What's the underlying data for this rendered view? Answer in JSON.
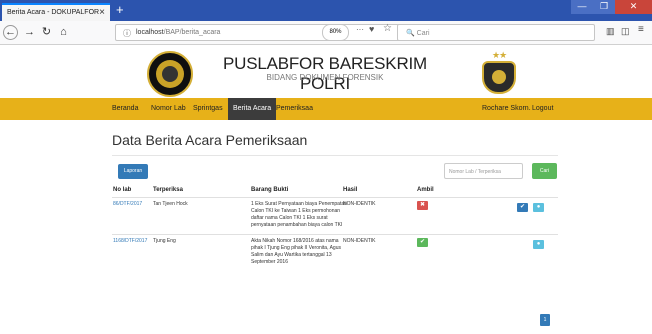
{
  "browser": {
    "tab_title": "Berita Acara - DOKUPALFOR",
    "tab_close": "×",
    "new_tab": "+",
    "url_host": "localhost",
    "url_path": "/BAP/berita_acara",
    "zoom": "80%",
    "more": "···",
    "search_placeholder": "Cari",
    "window_min": "—",
    "window_max": "❐",
    "window_close": "✕"
  },
  "header": {
    "title": "PUSLABFOR BARESKRIM POLRI",
    "subtitle": "BIDANG DOKUMEN FORENSIK"
  },
  "nav": {
    "items": [
      "Beranda",
      "Nomor Lab",
      "Sprintgas",
      "Berita Acara",
      "Pemeriksaa"
    ],
    "active_index": 3,
    "user": "Rochare Skorn.",
    "logout": "Logout",
    "bg_color": "#e7b119"
  },
  "main": {
    "title": "Data Berita Acara Pemeriksaan",
    "laporan_button": "Laporan",
    "search_placeholder": "Nomor Lab / Terperiksa",
    "cari_button": "Cari",
    "columns": [
      "No lab",
      "Terperiksa",
      "Barang Bukti",
      "Hasil",
      "Ambil"
    ],
    "rows": [
      {
        "nolab": "86/DTF/2017",
        "terperiksa": "Tan Tjeen Hock",
        "bukti_lines": [
          "1 Eks Surat Pernyataan biaya Penempatan",
          "Calon TKI ke Taiwan 1 Eks permohonan",
          "daftar nama Calon TKI 1 Eks surat",
          "pernyataan penambahan biaya calon TKI"
        ],
        "hasil": "NON-IDENTIK",
        "ambil_status": "no"
      },
      {
        "nolab": "1168/DTF/2017",
        "terperiksa": "Tjung Eng",
        "bukti_lines": [
          "Akta Nikah Nomor 168/2016 atas nama",
          "pihak I Tjung Eng pihak II Veronita, Agus",
          "Salim dan Ayu Wartika tertanggal 13",
          "September 2016"
        ],
        "hasil": "NON-IDENTIK",
        "ambil_status": "yes"
      }
    ],
    "page": "1"
  }
}
